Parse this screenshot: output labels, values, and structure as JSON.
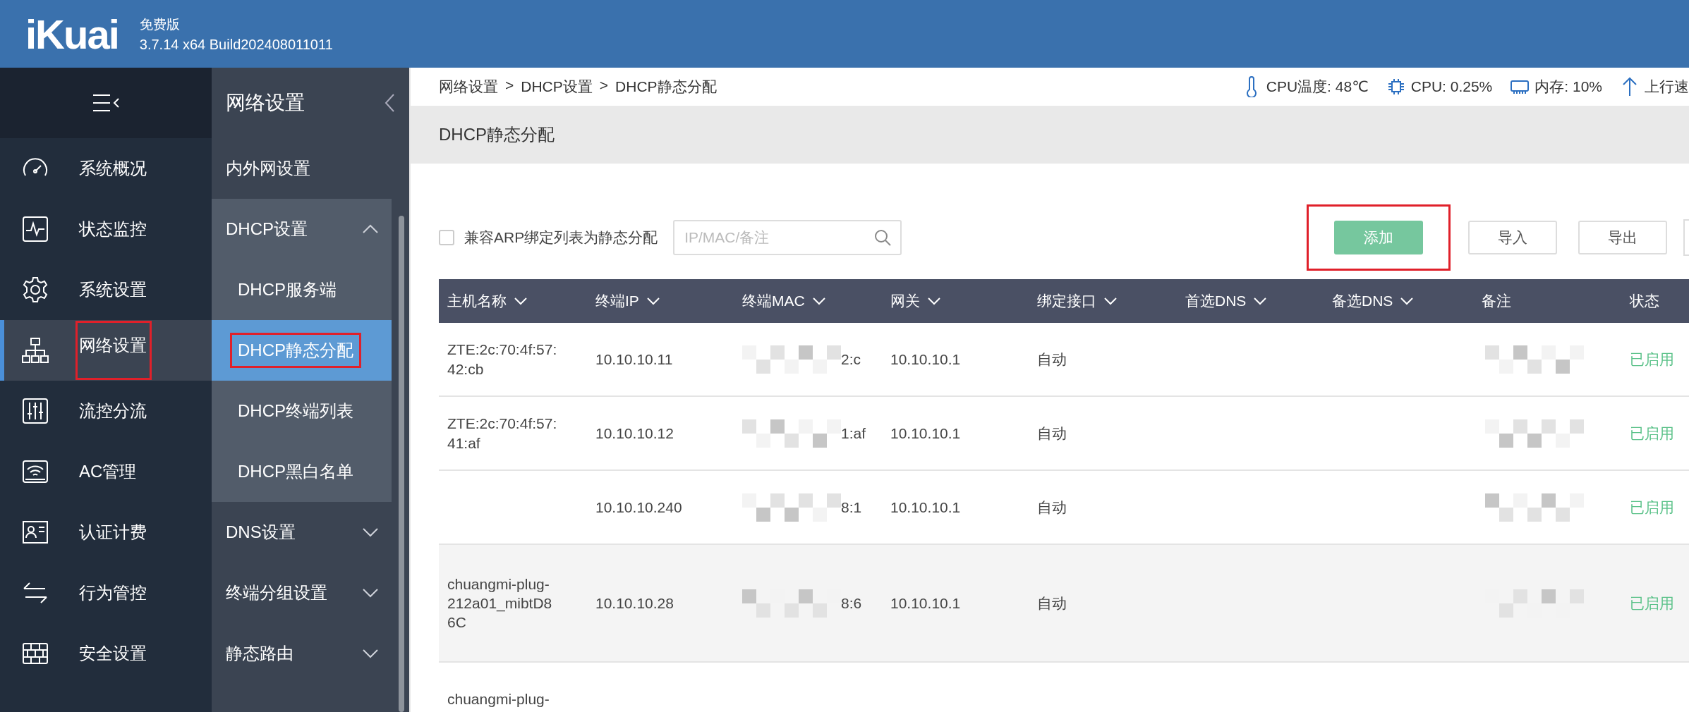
{
  "header": {
    "logo": "iKuai",
    "edition": "免费版",
    "version": "3.7.14 x64 Build202408011011"
  },
  "nav": {
    "items": [
      {
        "label": "系统概况",
        "selected": false,
        "marked": false
      },
      {
        "label": "状态监控",
        "selected": false,
        "marked": false
      },
      {
        "label": "系统设置",
        "selected": false,
        "marked": false
      },
      {
        "label": "网络设置",
        "selected": true,
        "marked": true
      },
      {
        "label": "流控分流",
        "selected": false,
        "marked": false
      },
      {
        "label": "AC管理",
        "selected": false,
        "marked": false
      },
      {
        "label": "认证计费",
        "selected": false,
        "marked": false
      },
      {
        "label": "行为管控",
        "selected": false,
        "marked": false
      },
      {
        "label": "安全设置",
        "selected": false,
        "marked": false
      }
    ]
  },
  "submenu": {
    "title": "网络设置",
    "items": [
      {
        "label": "内外网设置",
        "kind": "link"
      },
      {
        "label": "DHCP设置",
        "kind": "group",
        "expanded": true,
        "children": [
          {
            "label": "DHCP服务端",
            "selected": false,
            "marked": false
          },
          {
            "label": "DHCP静态分配",
            "selected": true,
            "marked": true
          },
          {
            "label": "DHCP终端列表",
            "selected": false,
            "marked": false
          },
          {
            "label": "DHCP黑白名单",
            "selected": false,
            "marked": false
          }
        ]
      },
      {
        "label": "DNS设置",
        "kind": "group",
        "expanded": false
      },
      {
        "label": "终端分组设置",
        "kind": "group",
        "expanded": false
      },
      {
        "label": "静态路由",
        "kind": "group",
        "expanded": false
      }
    ]
  },
  "breadcrumb": {
    "separator": ">",
    "items": [
      "网络设置",
      "DHCP设置",
      "DHCP静态分配"
    ]
  },
  "stats": [
    "CPU温度: 48℃",
    "CPU: 0.25%",
    "内存: 10%",
    "上行速"
  ],
  "page_title": "DHCP静态分配",
  "toolbar": {
    "checkbox": {
      "label": "兼容ARP绑定列表为静态分配",
      "checked": false
    },
    "search": {
      "placeholder": "IP/MAC/备注"
    },
    "buttons": [
      {
        "label": "添加",
        "kind": "primary",
        "marked": true
      },
      {
        "label": "导入",
        "kind": "default",
        "marked": false
      },
      {
        "label": "导出",
        "kind": "default",
        "marked": false
      }
    ]
  },
  "table": {
    "columns": [
      {
        "label": "主机名称",
        "sortable": true
      },
      {
        "label": "终端IP",
        "sortable": true
      },
      {
        "label": "终端MAC",
        "sortable": true
      },
      {
        "label": "网关",
        "sortable": true
      },
      {
        "label": "绑定接口",
        "sortable": true
      },
      {
        "label": "首选DNS",
        "sortable": true
      },
      {
        "label": "备选DNS",
        "sortable": true
      },
      {
        "label": "备注",
        "sortable": false
      },
      {
        "label": "状态",
        "sortable": false
      }
    ],
    "rows": [
      {
        "host": "ZTE:2c:70:4f:57:42:cb",
        "ip": "10.10.10.11",
        "mac": "2:c",
        "gateway": "10.10.10.1",
        "interface": "自动",
        "status": "已启用",
        "highlighted": false
      },
      {
        "host": "ZTE:2c:70:4f:57:41:af",
        "ip": "10.10.10.12",
        "mac": "1:af",
        "gateway": "10.10.10.1",
        "interface": "自动",
        "status": "已启用",
        "highlighted": false
      },
      {
        "ip": "10.10.10.240",
        "mac": "8:1",
        "gateway": "10.10.10.1",
        "interface": "自动",
        "status": "已启用",
        "highlighted": false
      },
      {
        "host": "chuangmi-plug-212a01_mibtD86C",
        "ip": "10.10.10.28",
        "mac": "8:6",
        "gateway": "10.10.10.1",
        "interface": "自动",
        "status": "已启用",
        "highlighted": true
      },
      {
        "host": "chuangmi-plug-",
        "highlighted": false
      }
    ]
  }
}
